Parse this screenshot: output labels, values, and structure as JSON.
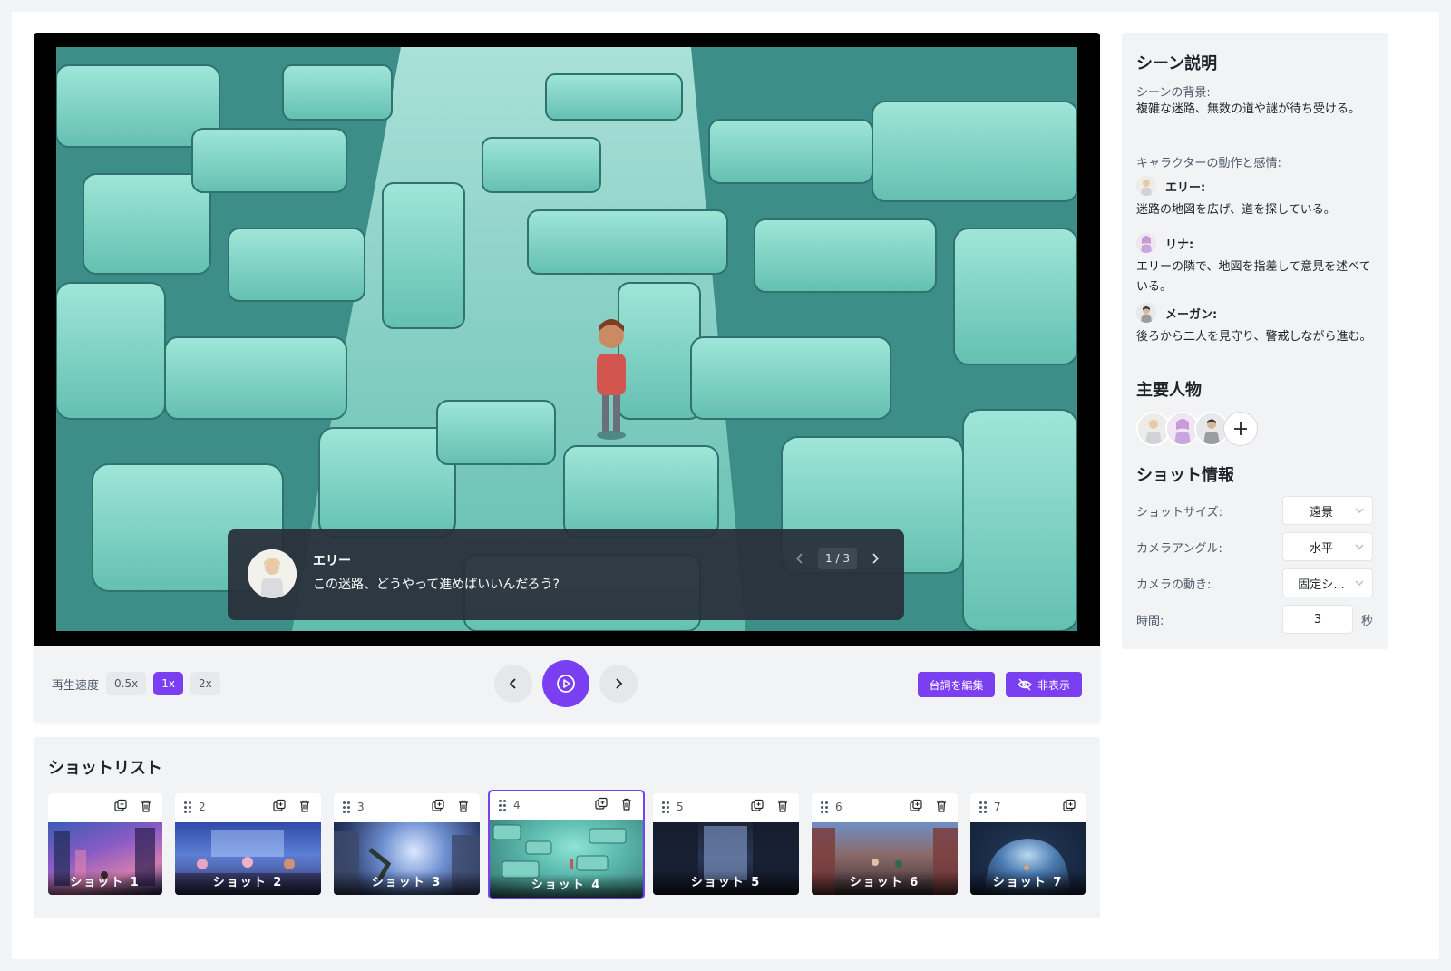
{
  "player": {
    "subtitle": {
      "speaker": "エリー",
      "line": "この迷路、どうやって進めばいいんだろう?",
      "page": "1 / 3"
    },
    "speed_label": "再生速度",
    "speeds": [
      "0.5x",
      "1x",
      "2x"
    ],
    "active_speed": "1x",
    "edit_lines_label": "台詞を編集",
    "hide_label": "非表示"
  },
  "shotlist": {
    "title": "ショットリスト",
    "active_index": 4,
    "shots": [
      {
        "num": "",
        "label": "ショット 1"
      },
      {
        "num": "2",
        "label": "ショット 2"
      },
      {
        "num": "3",
        "label": "ショット 3"
      },
      {
        "num": "4",
        "label": "ショット 4"
      },
      {
        "num": "5",
        "label": "ショット 5"
      },
      {
        "num": "6",
        "label": "ショット 6"
      },
      {
        "num": "7",
        "label": "ショット 7"
      }
    ]
  },
  "side": {
    "scene_title": "シーン説明",
    "background_label": "シーンの背景:",
    "background_text": "複雑な迷路、無数の道や謎が待ち受ける。",
    "actions_label": "キャラクターの動作と感情:",
    "characters": [
      {
        "name": "エリー:",
        "desc": "迷路の地図を広げ、道を探している。"
      },
      {
        "name": "リナ:",
        "desc": "エリーの隣で、地図を指差して意見を述べている。"
      },
      {
        "name": "メーガン:",
        "desc": "後ろから二人を見守り、警戒しながら進む。"
      }
    ],
    "main_chars_title": "主要人物",
    "shot_info_title": "ショット情報",
    "shot_size_label": "ショットサイズ:",
    "shot_size_value": "遠景",
    "camera_angle_label": "カメラアングル:",
    "camera_angle_value": "水平",
    "camera_move_label": "カメラの動き:",
    "camera_move_value": "固定シ...",
    "duration_label": "時間:",
    "duration_value": "3",
    "duration_unit": "秒"
  },
  "colors": {
    "accent": "#7b3ff2",
    "panel": "#f2f3f5"
  },
  "icons": [
    "chevron-left-icon",
    "chevron-right-icon",
    "play-circle-icon",
    "eye-off-icon",
    "duplicate-icon",
    "trash-icon",
    "drag-handle-icon",
    "plus-icon",
    "chevron-down-icon"
  ]
}
